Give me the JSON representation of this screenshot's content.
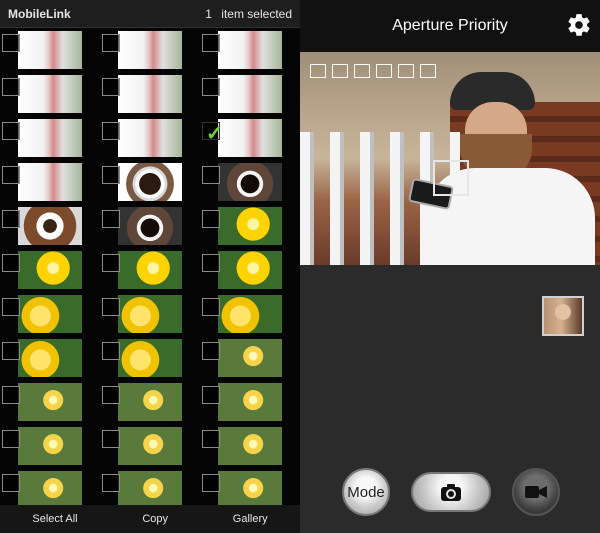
{
  "left_panel": {
    "app_title": "MobileLink",
    "selected_count": "1",
    "selected_suffix": "item selected",
    "footer": {
      "select_all": "Select All",
      "copy": "Copy",
      "gallery": "Gallery"
    },
    "thumbnails": [
      {
        "type": "bag",
        "checked": false
      },
      {
        "type": "bag",
        "checked": false
      },
      {
        "type": "bag",
        "checked": false
      },
      {
        "type": "bag",
        "checked": false
      },
      {
        "type": "bag",
        "checked": false
      },
      {
        "type": "bag",
        "checked": false
      },
      {
        "type": "bag",
        "checked": false
      },
      {
        "type": "bag",
        "checked": false
      },
      {
        "type": "bag",
        "checked": true
      },
      {
        "type": "bag",
        "checked": false
      },
      {
        "type": "cup",
        "checked": false
      },
      {
        "type": "cupdark",
        "checked": false
      },
      {
        "type": "beans",
        "checked": false
      },
      {
        "type": "cupdark",
        "checked": false
      },
      {
        "type": "rose",
        "checked": false
      },
      {
        "type": "rose",
        "checked": false
      },
      {
        "type": "rose",
        "checked": false
      },
      {
        "type": "rose",
        "checked": false
      },
      {
        "type": "rose2",
        "checked": false
      },
      {
        "type": "rose2",
        "checked": false
      },
      {
        "type": "rose2",
        "checked": false
      },
      {
        "type": "rose2",
        "checked": false
      },
      {
        "type": "rose2",
        "checked": false
      },
      {
        "type": "flower",
        "checked": false
      },
      {
        "type": "flower",
        "checked": false
      },
      {
        "type": "flower",
        "checked": false
      },
      {
        "type": "flower",
        "checked": false
      },
      {
        "type": "flower",
        "checked": false
      },
      {
        "type": "flower",
        "checked": false
      },
      {
        "type": "flower",
        "checked": false
      },
      {
        "type": "flower",
        "checked": false
      },
      {
        "type": "flower",
        "checked": false
      },
      {
        "type": "flower",
        "checked": false
      }
    ]
  },
  "right_panel": {
    "mode_title": "Aperture Priority",
    "mode_button": "Mode",
    "icons": {
      "settings": "gear-icon",
      "shutter": "camera-icon",
      "record": "video-icon"
    }
  }
}
